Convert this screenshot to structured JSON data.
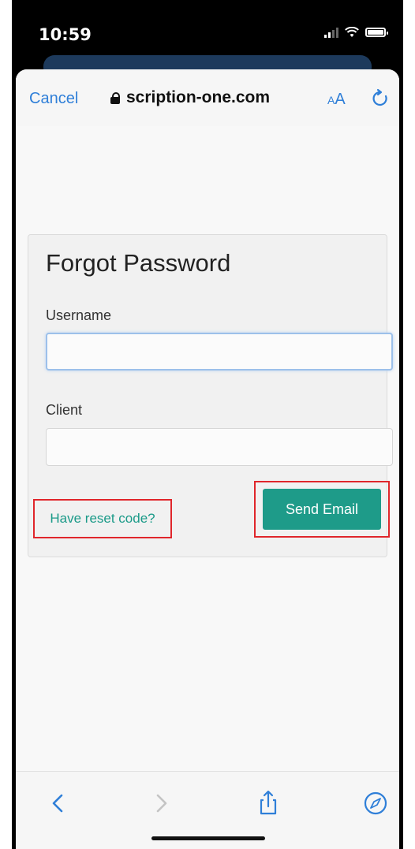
{
  "status_bar": {
    "time": "10:59",
    "icons": [
      "signal-icon",
      "wifi-icon",
      "battery-icon"
    ]
  },
  "browser": {
    "cancel_label": "Cancel",
    "url": "scription-one.com",
    "text_size_small": "A",
    "text_size_big": "A",
    "icons": {
      "lock": "lock-icon",
      "reload": "reload-icon"
    }
  },
  "form": {
    "title": "Forgot Password",
    "username_label": "Username",
    "username_value": "",
    "client_label": "Client",
    "client_value": "",
    "reset_link_label": "Have reset code?",
    "send_button_label": "Send Email"
  },
  "toolbar": {
    "items": [
      "back-icon",
      "forward-icon",
      "share-icon",
      "compass-icon"
    ]
  },
  "colors": {
    "accent_blue": "#2f7fd8",
    "teal": "#1e9b89",
    "highlight_red": "#e0262b"
  }
}
